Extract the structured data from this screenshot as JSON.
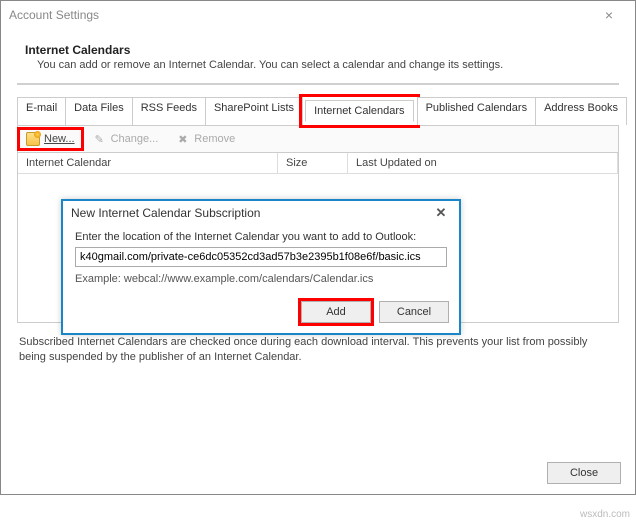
{
  "window": {
    "title": "Account Settings",
    "close_x": "×"
  },
  "section": {
    "title": "Internet Calendars",
    "desc": "You can add or remove an Internet Calendar. You can select a calendar and change its settings."
  },
  "tabs": {
    "email": "E-mail",
    "datafiles": "Data Files",
    "rss": "RSS Feeds",
    "sharepoint": "SharePoint Lists",
    "internetcal": "Internet Calendars",
    "published": "Published Calendars",
    "addrbooks": "Address Books"
  },
  "toolbar": {
    "new_label": "New...",
    "change_label": "Change...",
    "remove_label": "Remove"
  },
  "columns": {
    "ic": "Internet Calendar",
    "size": "Size",
    "lu": "Last Updated on"
  },
  "modal": {
    "title": "New Internet Calendar Subscription",
    "close_x": "✕",
    "prompt": "Enter the location of the Internet Calendar you want to add to Outlook:",
    "value": "k40gmail.com/private-ce6dc05352cd3ad57b3e2395b1f08e6f/basic.ics",
    "example": "Example: webcal://www.example.com/calendars/Calendar.ics",
    "add": "Add",
    "cancel": "Cancel"
  },
  "note": "Subscribed Internet Calendars are checked once during each download interval. This prevents your list from possibly being suspended by the publisher of an Internet Calendar.",
  "close_btn": "Close",
  "watermark": "wsxdn.com"
}
